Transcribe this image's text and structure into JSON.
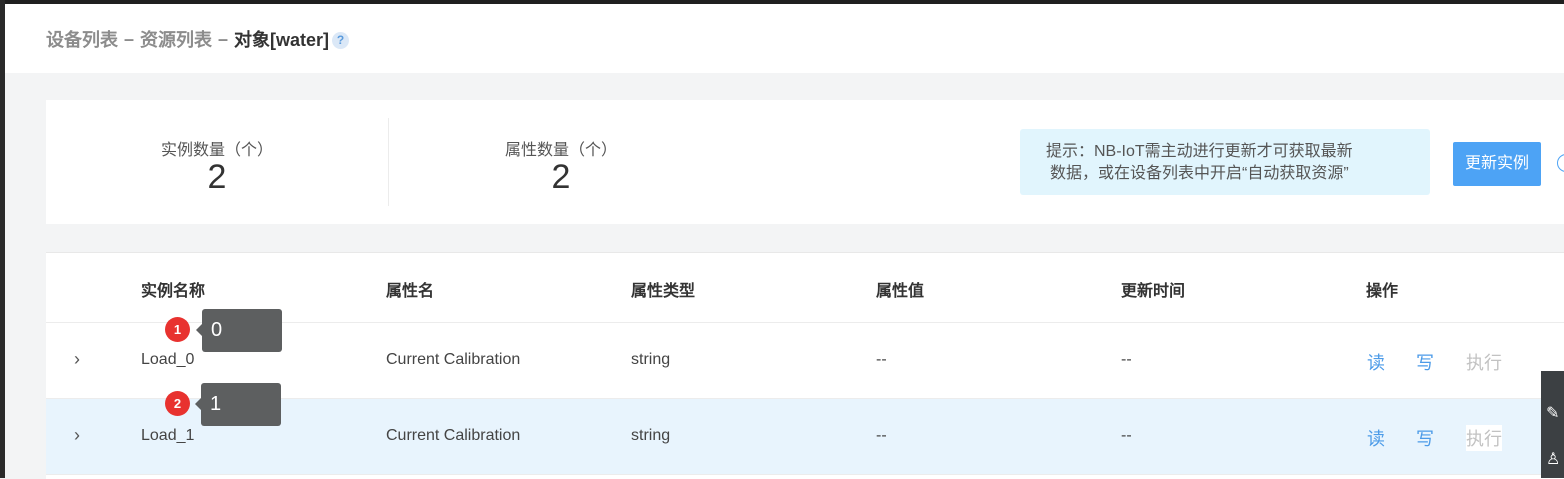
{
  "breadcrumb": {
    "items": [
      "设备列表",
      "资源列表"
    ],
    "separator": "–",
    "current": "对象[water]",
    "help_icon": "question-circle-icon"
  },
  "stats": {
    "instance_label": "实例数量（个）",
    "instance_value": "2",
    "attribute_label": "属性数量（个）",
    "attribute_value": "2",
    "hint_line1": "提示：NB-IoT需主动进行更新才可获取最新",
    "hint_line2": "数据，或在设备列表中开启“自动获取资源”",
    "refresh_button": "更新实例",
    "info_icon": "info-circle-icon"
  },
  "table": {
    "columns": [
      "实例名称",
      "属性名",
      "属性类型",
      "属性值",
      "更新时间",
      "操作"
    ],
    "rows": [
      {
        "name": "Load_0",
        "attribute": "Current Calibration",
        "type": "string",
        "value": "--",
        "updated": "--",
        "ops": [
          "读",
          "写",
          "执行"
        ],
        "expand_icon": "chevron-right-icon"
      },
      {
        "name": "Load_1",
        "attribute": "Current Calibration",
        "type": "string",
        "value": "--",
        "updated": "--",
        "ops": [
          "读",
          "写",
          "执行"
        ],
        "expand_icon": "chevron-right-icon"
      }
    ]
  },
  "annotations": [
    {
      "badge": "1",
      "tooltip": "0"
    },
    {
      "badge": "2",
      "tooltip": "1"
    }
  ],
  "colors": {
    "accent": "#4da3f5",
    "badge": "#e8322f",
    "selected_row": "#e8f4fd",
    "hint_bg": "#e1f5fd"
  }
}
